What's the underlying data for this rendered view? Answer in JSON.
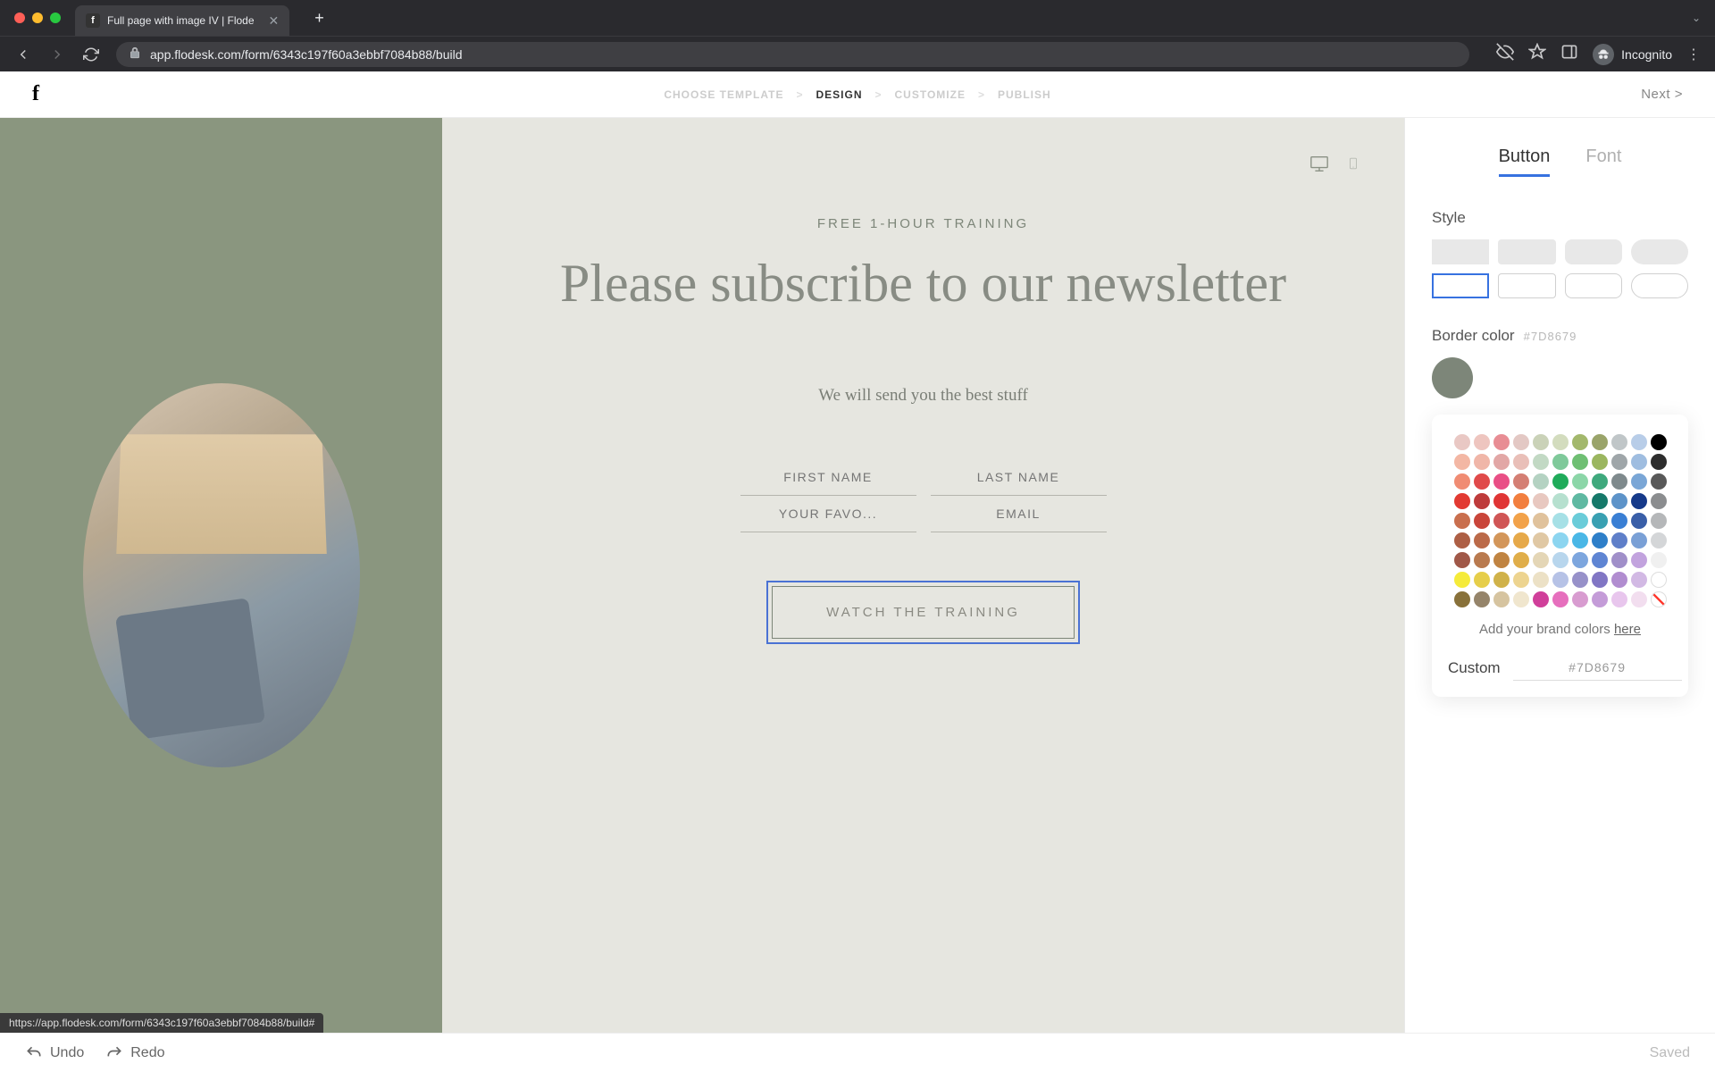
{
  "browser": {
    "tab_title": "Full page with image IV | Flode",
    "url": "app.flodesk.com/form/6343c197f60a3ebbf7084b88/build",
    "incognito_label": "Incognito",
    "status_link": "https://app.flodesk.com/form/6343c197f60a3ebbf7084b88/build#"
  },
  "header": {
    "logo": "f",
    "steps": [
      "CHOOSE TEMPLATE",
      "DESIGN",
      "CUSTOMIZE",
      "PUBLISH"
    ],
    "active_step_index": 1,
    "next_label": "Next  >"
  },
  "preview": {
    "eyebrow": "FREE 1-HOUR TRAINING",
    "headline": "Please subscribe to our newsletter",
    "subtext": "We will send you the best stuff",
    "fields": {
      "first_name": "FIRST NAME",
      "last_name": "LAST NAME",
      "favorite": "YOUR FAVO...",
      "email": "EMAIL"
    },
    "cta": "WATCH THE TRAINING"
  },
  "sidebar": {
    "tabs": [
      "Button",
      "Font"
    ],
    "active_tab_index": 0,
    "style_label": "Style",
    "border_color_label": "Border color",
    "border_color_hex": "#7D8679",
    "current_color": "#7D8679",
    "brand_colors_prefix": "Add your brand colors ",
    "brand_colors_link": "here",
    "custom_label": "Custom",
    "custom_value": "#7D8679",
    "palette": [
      "#e9c8c4",
      "#eec5bf",
      "#e88d94",
      "#e3c8c4",
      "#cad2b8",
      "#d3dcbe",
      "#a3b86c",
      "#9aa46a",
      "#c0c6c8",
      "#b8cde8",
      "#000000",
      "#f3b7a4",
      "#f0b6a8",
      "#e2a7a6",
      "#e9bfb8",
      "#c2d9c4",
      "#7fc99a",
      "#6fbf73",
      "#9bb65f",
      "#9fa6a9",
      "#9fbde0",
      "#2d2d2d",
      "#f08c73",
      "#e04a4a",
      "#e94f86",
      "#d47f74",
      "#b4d2c2",
      "#20ab5a",
      "#8cd6a8",
      "#3fa97d",
      "#7f8a8d",
      "#7aa6d6",
      "#595959",
      "#e23a32",
      "#be3b3b",
      "#e03535",
      "#f27f3f",
      "#e8c8c0",
      "#b6e0cf",
      "#5fb9a2",
      "#16796a",
      "#5d93c9",
      "#163a8a",
      "#8b8d8f",
      "#c96f4e",
      "#c9453a",
      "#d05656",
      "#f2a24a",
      "#e0c29c",
      "#a6e0e6",
      "#6accd9",
      "#39a0b2",
      "#3a7fd4",
      "#3a5fa8",
      "#b5b7b9",
      "#ad5f45",
      "#bb6a49",
      "#d3965a",
      "#e6a94a",
      "#e0c8a4",
      "#8cd5f0",
      "#4ab7e6",
      "#2e7fc9",
      "#5f7fc9",
      "#7aa0d6",
      "#d4d6d8",
      "#a05848",
      "#b97a4f",
      "#c08442",
      "#e0ae4a",
      "#e4d6b6",
      "#b8d6ed",
      "#7da6de",
      "#5f85d3",
      "#a08fc9",
      "#c2a3de",
      "#f0f0f0",
      "#f5eb3a",
      "#e6ce4a",
      "#d0b24a",
      "#edd490",
      "#ece1c6",
      "#b6c2e6",
      "#9791c9",
      "#8176c4",
      "#b18dd0",
      "#d2b9e4",
      "#ffffff",
      "#88713a",
      "#95846a",
      "#d6c4a0",
      "#f0e6ce",
      "#d03f9a",
      "#e66fbd",
      "#d89cd0",
      "#c49cd8",
      "#e8c6ed",
      "#f2deef",
      "#ff3b30"
    ]
  },
  "bottom": {
    "undo": "Undo",
    "redo": "Redo",
    "saved": "Saved"
  }
}
